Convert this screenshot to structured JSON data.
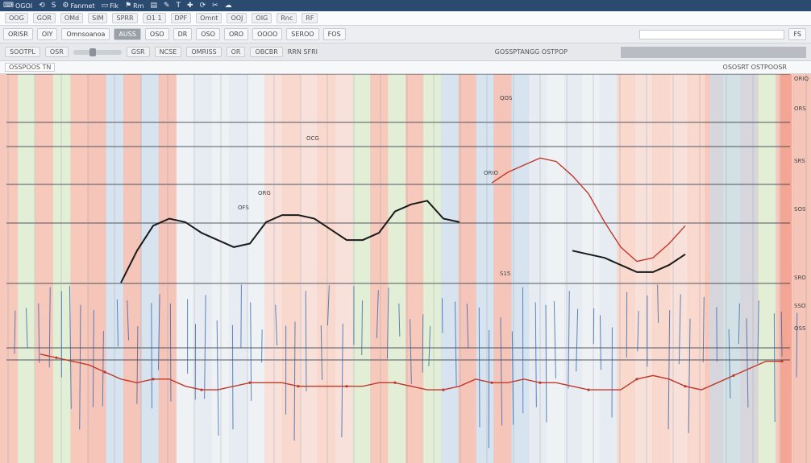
{
  "titlebar": {
    "items": [
      {
        "label": "⌨",
        "text": "OGOI"
      },
      {
        "label": "⟲",
        "text": ""
      },
      {
        "label": "S",
        "text": ""
      },
      {
        "label": "⚙",
        "text": "Fanrnet"
      },
      {
        "label": "▭",
        "text": "Fik"
      },
      {
        "label": "⚑",
        "text": "Rm"
      },
      {
        "label": "▤",
        "text": ""
      },
      {
        "label": "✎",
        "text": ""
      },
      {
        "label": "T",
        "text": ""
      },
      {
        "label": "✚",
        "text": ""
      },
      {
        "label": "⟳",
        "text": ""
      },
      {
        "label": "✂",
        "text": ""
      },
      {
        "label": "☁",
        "text": ""
      }
    ]
  },
  "menubar": {
    "items": [
      "OOG",
      "GOR",
      "OMd",
      "SIM",
      "SPRR",
      "O1 1",
      "DPF",
      "Omnt",
      "OOJ",
      "OIG",
      "Rnc",
      "RF"
    ]
  },
  "toolbar": {
    "items": [
      "ORISR",
      "OIY",
      "Omnsoanoa",
      "AUSS",
      "OSO",
      "DR",
      "OSO",
      "ORO",
      "OOOO",
      "SEROO",
      "FOS"
    ],
    "search_placeholder": "",
    "right_value": "FS"
  },
  "optionsbar": {
    "items": [
      "SOOTPL",
      "OSR",
      "GSR",
      "NCSE",
      "OMRISS",
      "OR",
      "OBCBR"
    ],
    "readout": "GOSSPTANGG OSTPOP",
    "cursor_readout": "RRN SFRI"
  },
  "statusbar": {
    "left": "OSSPOOS TN",
    "right": "OSOSRT OSTPOOSR"
  },
  "chart_annotations": {
    "notes": [
      "OCG",
      "QOS",
      "ORG",
      "OFS",
      "S15",
      "ORIO",
      "ORIQ",
      "ORS",
      "SRS",
      "SOS",
      "SRO",
      "SSO",
      "OSS"
    ]
  },
  "chart_data": {
    "type": "line",
    "x": [
      0,
      1,
      2,
      3,
      4,
      5,
      6,
      7,
      8,
      9,
      10,
      11,
      12,
      13,
      14,
      15,
      16,
      17,
      18,
      19,
      20,
      21,
      22,
      23,
      24,
      25,
      26,
      27,
      28,
      29,
      30,
      31,
      32,
      33,
      34,
      35,
      36,
      37,
      38,
      39,
      40,
      41,
      42,
      43,
      44,
      45,
      46,
      47,
      48
    ],
    "series": [
      {
        "color": "#1a1a1a",
        "values": [
          null,
          null,
          null,
          null,
          null,
          null,
          null,
          3.6,
          4.5,
          5.2,
          5.4,
          5.3,
          5.0,
          4.8,
          4.6,
          4.7,
          5.3,
          5.5,
          5.5,
          5.4,
          5.1,
          4.8,
          4.8,
          5.0,
          5.6,
          5.8,
          5.9,
          5.4,
          5.3,
          null,
          null,
          null,
          null,
          null,
          null,
          4.5,
          4.4,
          4.3,
          4.1,
          3.9,
          3.9,
          4.1,
          4.4,
          null,
          null,
          null,
          null,
          null,
          null
        ]
      },
      {
        "color": "#c0392b",
        "values": [
          null,
          null,
          1.6,
          1.5,
          1.4,
          1.3,
          1.1,
          0.9,
          0.8,
          0.9,
          0.9,
          0.7,
          0.6,
          0.6,
          0.7,
          0.8,
          0.8,
          0.8,
          0.7,
          0.7,
          0.7,
          0.7,
          0.7,
          0.8,
          0.8,
          0.7,
          0.6,
          0.6,
          0.7,
          0.9,
          0.8,
          0.8,
          0.9,
          0.8,
          0.8,
          0.7,
          0.6,
          0.6,
          0.6,
          0.9,
          1.0,
          0.9,
          0.7,
          0.6,
          0.8,
          1.0,
          1.2,
          1.4,
          1.4
        ]
      },
      {
        "color": "#c0392b",
        "values": [
          null,
          null,
          null,
          null,
          null,
          null,
          null,
          null,
          null,
          null,
          null,
          null,
          null,
          null,
          null,
          null,
          null,
          null,
          null,
          null,
          null,
          null,
          null,
          null,
          null,
          null,
          null,
          null,
          null,
          null,
          6.4,
          6.7,
          6.9,
          7.1,
          7.0,
          6.6,
          6.1,
          5.3,
          4.6,
          4.2,
          4.3,
          4.7,
          5.2,
          null,
          null,
          null,
          null,
          null,
          null
        ]
      }
    ],
    "ylim": [
      -1,
      9
    ],
    "grid": true
  },
  "colors": {
    "band_palette": [
      "#f4b7a6",
      "#f7cbbd",
      "#dfe6ef",
      "#c9dbeb",
      "#d9e8c8",
      "#f6d7cf",
      "#e9edf2",
      "#f2b2a2"
    ]
  }
}
